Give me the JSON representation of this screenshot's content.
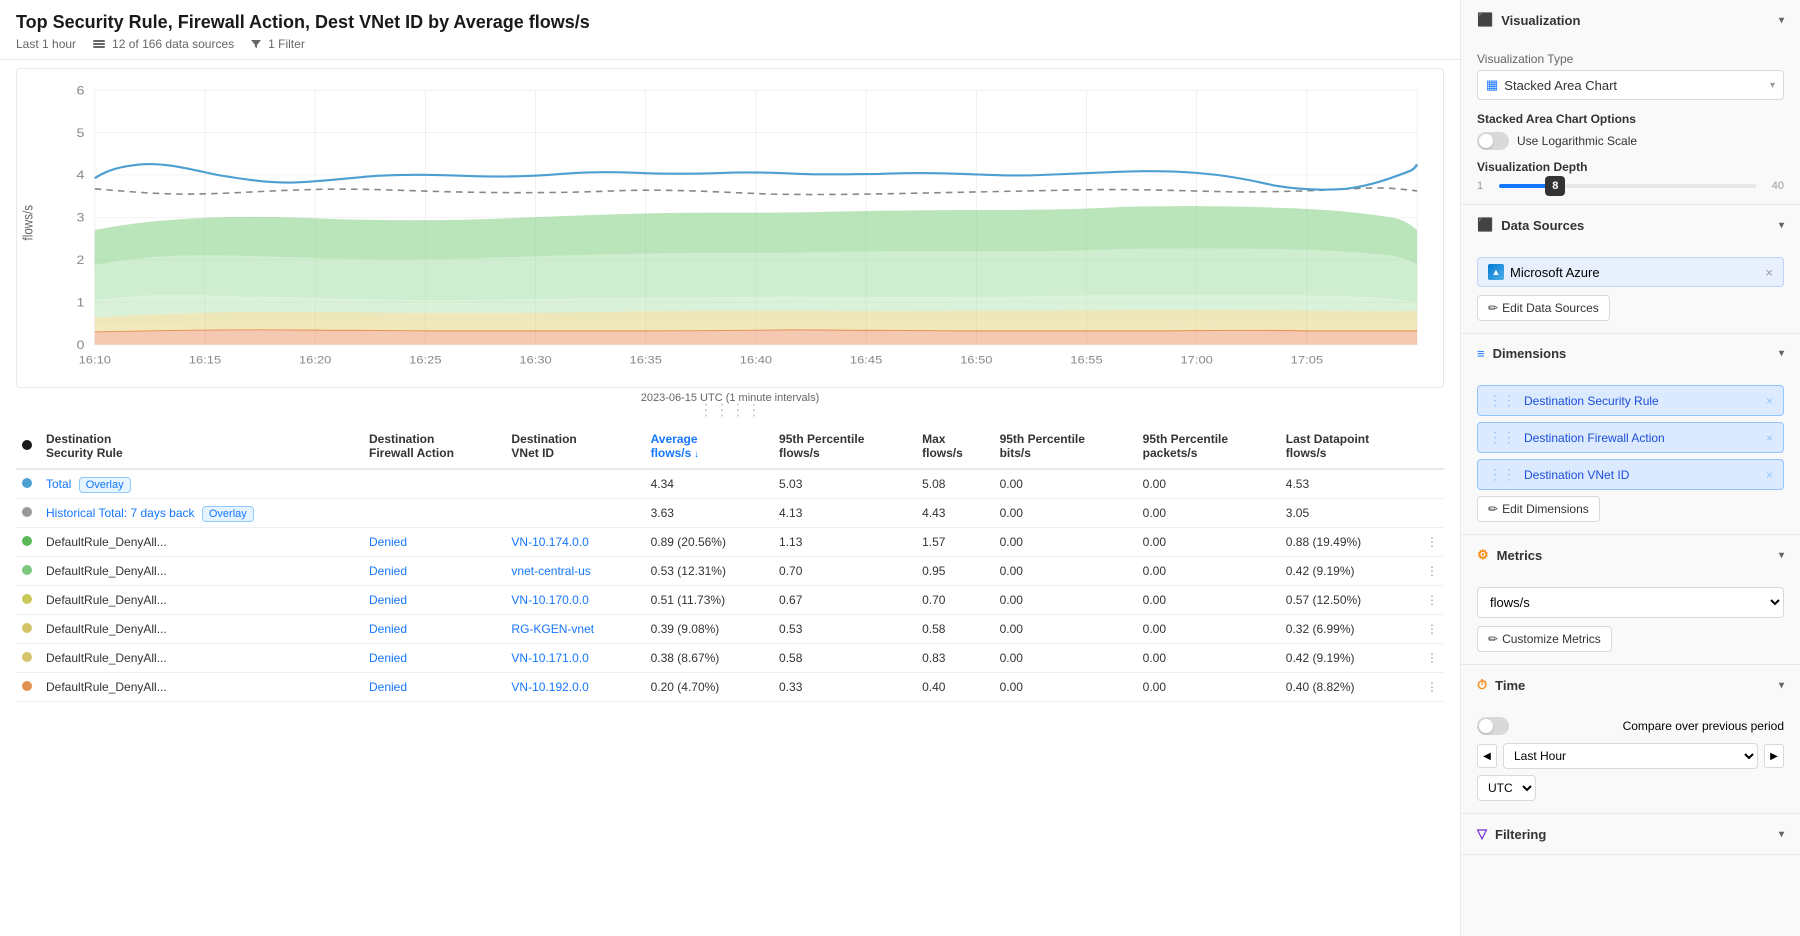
{
  "header": {
    "title": "Top Security Rule, Firewall Action, Dest VNet ID by Average flows/s",
    "time_range": "Last 1 hour",
    "data_sources": "12 of 166 data sources",
    "filter": "1 Filter"
  },
  "chart": {
    "y_axis_label": "flows/s",
    "y_axis_values": [
      "6",
      "5",
      "4",
      "3",
      "2",
      "1",
      "0"
    ],
    "x_axis_label": "2023-06-15 UTC (1 minute intervals)",
    "x_ticks": [
      "16:10",
      "16:15",
      "16:20",
      "16:25",
      "16:30",
      "16:35",
      "16:40",
      "16:45",
      "16:50",
      "16:55",
      "17:00",
      "17:05"
    ]
  },
  "table": {
    "columns": [
      {
        "key": "color",
        "label": ""
      },
      {
        "key": "security_rule",
        "label": "Destination Security Rule"
      },
      {
        "key": "firewall_action",
        "label": "Destination Firewall Action"
      },
      {
        "key": "vnet_id",
        "label": "Destination VNet ID"
      },
      {
        "key": "avg_flows",
        "label": "Average flows/s"
      },
      {
        "key": "p95_flows",
        "label": "95th Percentile flows/s"
      },
      {
        "key": "max_flows",
        "label": "Max flows/s"
      },
      {
        "key": "p95_bits",
        "label": "95th Percentile bits/s"
      },
      {
        "key": "p95_packets",
        "label": "95th Percentile packets/s"
      },
      {
        "key": "last_dp",
        "label": "Last Datapoint flows/s"
      }
    ],
    "rows": [
      {
        "color": "blue",
        "security_rule": "Total",
        "firewall_action": "",
        "vnet_id": "",
        "tag": "Overlay",
        "avg_flows": "4.34",
        "avg_pct": "",
        "p95_flows": "5.03",
        "max_flows": "5.08",
        "p95_bits": "0.00",
        "p95_packets": "0.00",
        "last_dp": "4.53"
      },
      {
        "color": "gray",
        "security_rule": "Historical Total: 7 days back",
        "firewall_action": "",
        "vnet_id": "",
        "tag": "Overlay",
        "avg_flows": "3.63",
        "avg_pct": "",
        "p95_flows": "4.13",
        "max_flows": "4.43",
        "p95_bits": "0.00",
        "p95_packets": "0.00",
        "last_dp": "3.05"
      },
      {
        "color": "green1",
        "security_rule": "DefaultRule_DenyAll...",
        "firewall_action": "Denied",
        "vnet_id": "VN-10.174.0.0",
        "avg_flows": "0.89",
        "avg_pct": "(20.56%)",
        "p95_flows": "1.13",
        "max_flows": "1.57",
        "p95_bits": "0.00",
        "p95_packets": "0.00",
        "last_dp": "0.88",
        "last_pct": "(19.49%)"
      },
      {
        "color": "green2",
        "security_rule": "DefaultRule_DenyAll...",
        "firewall_action": "Denied",
        "vnet_id": "vnet-central-us",
        "avg_flows": "0.53",
        "avg_pct": "(12.31%)",
        "p95_flows": "0.70",
        "max_flows": "0.95",
        "p95_bits": "0.00",
        "p95_packets": "0.00",
        "last_dp": "0.42",
        "last_pct": "(9.19%)"
      },
      {
        "color": "yellow1",
        "security_rule": "DefaultRule_DenyAll...",
        "firewall_action": "Denied",
        "vnet_id": "VN-10.170.0.0",
        "avg_flows": "0.51",
        "avg_pct": "(11.73%)",
        "p95_flows": "0.67",
        "max_flows": "0.70",
        "p95_bits": "0.00",
        "p95_packets": "0.00",
        "last_dp": "0.57",
        "last_pct": "(12.50%)"
      },
      {
        "color": "yellow2",
        "security_rule": "DefaultRule_DenyAll...",
        "firewall_action": "Denied",
        "vnet_id": "RG-KGEN-vnet",
        "avg_flows": "0.39",
        "avg_pct": "(9.08%)",
        "p95_flows": "0.53",
        "max_flows": "0.58",
        "p95_bits": "0.00",
        "p95_packets": "0.00",
        "last_dp": "0.32",
        "last_pct": "(6.99%)"
      },
      {
        "color": "yellow2",
        "security_rule": "DefaultRule_DenyAll...",
        "firewall_action": "Denied",
        "vnet_id": "VN-10.171.0.0",
        "avg_flows": "0.38",
        "avg_pct": "(8.67%)",
        "p95_flows": "0.58",
        "max_flows": "0.83",
        "p95_bits": "0.00",
        "p95_packets": "0.00",
        "last_dp": "0.42",
        "last_pct": "(9.19%)"
      },
      {
        "color": "orange",
        "security_rule": "DefaultRule_DenyAll...",
        "firewall_action": "Denied",
        "vnet_id": "VN-10.192.0.0",
        "avg_flows": "0.20",
        "avg_pct": "(4.70%)",
        "p95_flows": "0.33",
        "max_flows": "0.40",
        "p95_bits": "0.00",
        "p95_packets": "0.00",
        "last_dp": "0.40",
        "last_pct": "(8.82%)"
      }
    ]
  },
  "sidebar": {
    "visualization_section": {
      "title": "Visualization",
      "type_label": "Visualization Type",
      "type_value": "Stacked Area Chart",
      "options_label": "Stacked Area Chart Options",
      "log_scale_label": "Use Logarithmic Scale",
      "depth_label": "Visualization Depth",
      "depth_min": "1",
      "depth_max": "40",
      "depth_value": "8"
    },
    "data_sources_section": {
      "title": "Data Sources",
      "source": "Microsoft Azure",
      "edit_button": "Edit Data Sources"
    },
    "dimensions_section": {
      "title": "Dimensions",
      "items": [
        "Destination Security Rule",
        "Destination Firewall Action",
        "Destination VNet ID"
      ],
      "edit_button": "Edit Dimensions"
    },
    "metrics_section": {
      "title": "Metrics",
      "metric_value": "flows/s",
      "customize_button": "Customize Metrics"
    },
    "time_section": {
      "title": "Time",
      "compare_label": "Compare over previous period",
      "time_range": "Last Hour",
      "timezone": "UTC"
    },
    "filtering_section": {
      "title": "Filtering"
    }
  },
  "icons": {
    "viz_icon": "▦",
    "data_icon": "⬛",
    "dimensions_icon": "≡",
    "metrics_icon": "⚙",
    "time_icon": "⏱",
    "filter_icon": "▽",
    "pencil_icon": "✏",
    "chevron_down": "▾",
    "chevron_up": "▴",
    "drag": "⋮⋮",
    "close": "×",
    "area_chart_icon": "📊"
  }
}
